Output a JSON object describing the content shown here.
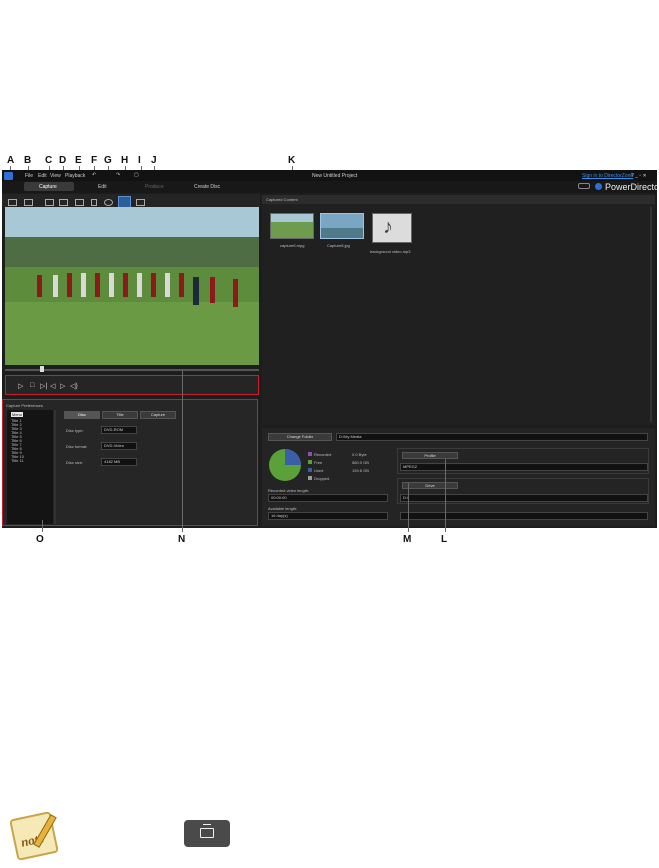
{
  "callouts": {
    "top": [
      "A",
      "B",
      "C",
      "D",
      "E",
      "F",
      "G",
      "H",
      "I",
      "J",
      "K"
    ],
    "bottom": [
      "O",
      "N",
      "M",
      "L"
    ]
  },
  "app": {
    "menu": [
      "File",
      "Edit",
      "View",
      "Playback"
    ],
    "project_title": "New Untitled Project",
    "sign_in": "Sign in to DirectorZone",
    "window_controls": "? _ ▫ ✕",
    "brand": "PowerDirector",
    "modes": [
      "Capture",
      "Edit",
      "Produce",
      "Create Disc"
    ],
    "captured_content_label": "Captured Content",
    "media": [
      {
        "name": "capture6.mpg"
      },
      {
        "name": "Capture8.jpg"
      },
      {
        "name": "background video.mp3"
      }
    ],
    "capture_prefs_label": "Capture Preferences",
    "tree": [
      "Menu",
      "Title 1",
      "Title 2",
      "Title 3",
      "Title 4",
      "Title 5",
      "Title 6",
      "Title 7",
      "Title 8",
      "Title 9",
      "Title 10",
      "Title 11"
    ],
    "tabs": [
      "Disc",
      "Title",
      "Capture"
    ],
    "disc": {
      "type_label": "Disc type:",
      "type_value": "DVD-ROM",
      "format_label": "Disc format:",
      "format_value": "DVD-Video",
      "size_label": "Disc size:",
      "size_value": "4182 MB"
    },
    "folder": {
      "button": "Change Folder",
      "path": "D:\\My Media"
    },
    "disk_legend": [
      {
        "label": "Recorded",
        "value": "0.0 Byte",
        "color": "#8a4fb8"
      },
      {
        "label": "Free",
        "value": "580.0 GB",
        "color": "#5aa13a"
      },
      {
        "label": "Used",
        "value": "139.6 GB",
        "color": "#3a5fa8"
      },
      {
        "label": "Dropped",
        "value": "",
        "color": "#9a9a9a"
      }
    ],
    "recorded_length_label": "Recorded video length:",
    "recorded_length_value": "00:00:00",
    "available_length_label": "Available length:",
    "available_length_value": "16 day(s)",
    "profile_button": "Profile",
    "profile_value": "MPEG2",
    "drive_button": "Drive",
    "drive_value": "D:\\"
  },
  "note": {
    "logo_text": "note"
  },
  "colors": {
    "accent_red": "#c8202a",
    "brand_blue": "#2f6fd6",
    "link_blue": "#3b8fe0"
  }
}
